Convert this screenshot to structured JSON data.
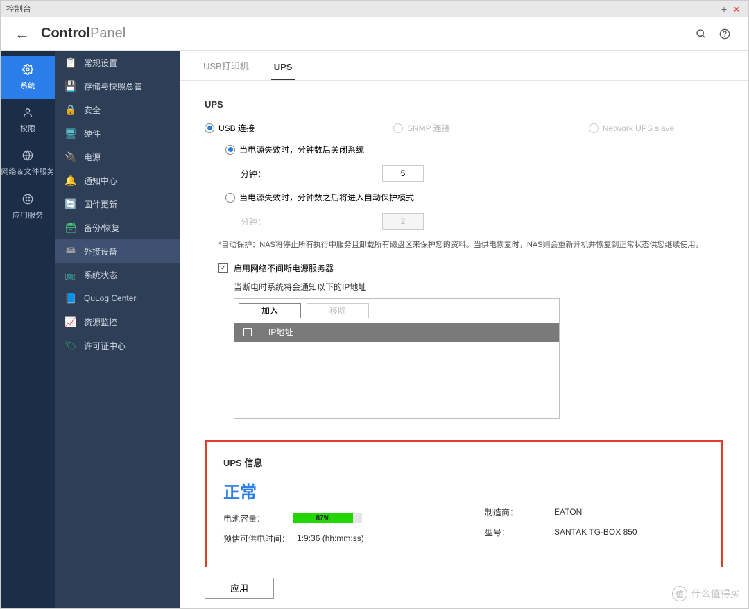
{
  "window_title": "控制台",
  "header": {
    "title_bold": "Control",
    "title_thin": "Panel"
  },
  "leftnav": [
    {
      "label": "系统",
      "active": true
    },
    {
      "label": "权限",
      "active": false
    },
    {
      "label": "网络＆文件服务",
      "active": false
    },
    {
      "label": "应用服务",
      "active": false
    }
  ],
  "sidebar": [
    {
      "label": "常规设置",
      "icon": "clipboard",
      "color": "#e0b060"
    },
    {
      "label": "存储与快照总管",
      "icon": "disk",
      "color": "#4aa3e0"
    },
    {
      "label": "安全",
      "icon": "lock",
      "color": "#d9c06a"
    },
    {
      "label": "硬件",
      "icon": "device",
      "color": "#5ac0c8"
    },
    {
      "label": "电源",
      "icon": "plug",
      "color": "#4cd080"
    },
    {
      "label": "通知中心",
      "icon": "bell",
      "color": "#e06aa8"
    },
    {
      "label": "固件更新",
      "icon": "update",
      "color": "#4aa3e0"
    },
    {
      "label": "备份/恢复",
      "icon": "restore",
      "color": "#4cd080"
    },
    {
      "label": "外接设备",
      "icon": "external",
      "color": "#a0a0a0",
      "active": true
    },
    {
      "label": "系统状态",
      "icon": "monitor",
      "color": "#4aa3e0"
    },
    {
      "label": "QuLog Center",
      "icon": "log",
      "color": "#3a8de0"
    },
    {
      "label": "资源监控",
      "icon": "chart",
      "color": "#6b6b6b"
    },
    {
      "label": "许可证中心",
      "icon": "license",
      "color": "#2aa868"
    }
  ],
  "tabs": [
    {
      "label": "USB打印机",
      "active": false
    },
    {
      "label": "UPS",
      "active": true
    }
  ],
  "section_title": "UPS",
  "conn_modes": {
    "usb": "USB 连接",
    "snmp": "SNMP 连接",
    "slave": "Network UPS slave"
  },
  "shutdown_option": "当电源失效时，分钟数后关闭系统",
  "protect_option": "当电源失效时，分钟数之后将进入自动保护模式",
  "minutes_label": "分钟：",
  "minutes_value": "5",
  "minutes_disabled": "2",
  "note": "*自动保护：NAS将停止所有执行中服务且卸载所有磁盘区来保护您的资料。当供电恢复时，NAS则会重新开机并恢复到正常状态供您继续使用。",
  "enable_server": "启用网络不间断电源服务器",
  "ip_desc": "当断电时系统将会通知以下的IP地址",
  "btn_add": "加入",
  "btn_remove": "移除",
  "th_ip": "IP地址",
  "ups_info": {
    "title": "UPS 信息",
    "status": "正常",
    "battery_label": "电池容量：",
    "battery_pct": 87,
    "runtime_label": "预估可供电时间：",
    "runtime_value": "1:9:36 (hh:mm:ss)",
    "maker_label": "制造商：",
    "maker_value": "EATON",
    "model_label": "型号：",
    "model_value": "SANTAK TG-BOX 850"
  },
  "apply": "应用",
  "watermark": "什么值得买"
}
